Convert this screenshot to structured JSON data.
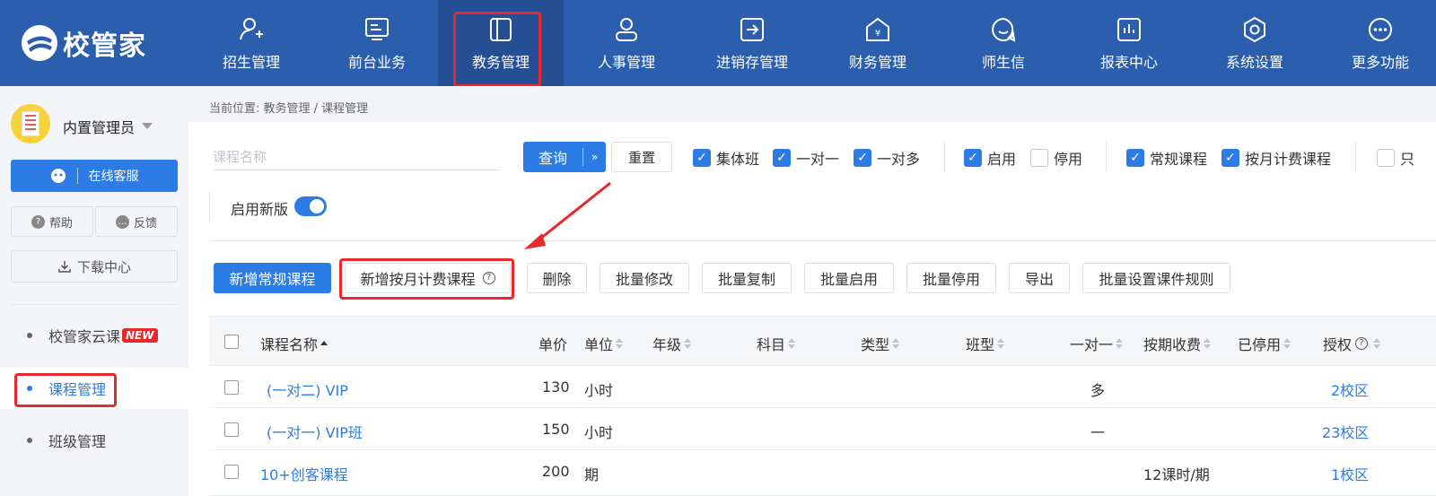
{
  "app": {
    "name": "校管家"
  },
  "nav": [
    {
      "label": "招生管理",
      "icon": "user-plus-icon"
    },
    {
      "label": "前台业务",
      "icon": "monitor-icon"
    },
    {
      "label": "教务管理",
      "icon": "book-icon",
      "active": true
    },
    {
      "label": "人事管理",
      "icon": "person-icon"
    },
    {
      "label": "进销存管理",
      "icon": "arrow-in-box-icon"
    },
    {
      "label": "财务管理",
      "icon": "yen-house-icon"
    },
    {
      "label": "师生信",
      "icon": "chat-bubble-icon"
    },
    {
      "label": "报表中心",
      "icon": "chart-icon"
    },
    {
      "label": "系统设置",
      "icon": "gear-icon"
    },
    {
      "label": "更多功能",
      "icon": "more-icon"
    }
  ],
  "sidebar": {
    "username": "内置管理员",
    "service_label": "在线客服",
    "help_label": "帮助",
    "feedback_label": "反馈",
    "download_label": "下载中心",
    "menu": [
      {
        "label": "校管家云课",
        "badge": "NEW"
      },
      {
        "label": "课程管理",
        "active": true
      },
      {
        "label": "班级管理"
      }
    ]
  },
  "breadcrumb": "当前位置: 教务管理 / 课程管理",
  "filters": {
    "search_placeholder": "课程名称",
    "query_label": "查询",
    "reset_label": "重置",
    "checkboxes": [
      {
        "label": "集体班",
        "checked": true
      },
      {
        "label": "一对一",
        "checked": true
      },
      {
        "label": "一对多",
        "checked": true
      },
      {
        "label": "启用",
        "checked": true
      },
      {
        "label": "停用",
        "checked": false
      },
      {
        "label": "常规课程",
        "checked": true
      },
      {
        "label": "按月计费课程",
        "checked": true
      },
      {
        "label": "只",
        "checked": false
      }
    ],
    "new_version_label": "启用新版",
    "new_version_on": true
  },
  "actions": {
    "add_regular": "新增常规课程",
    "add_monthly": "新增按月计费课程",
    "delete": "删除",
    "batch_edit": "批量修改",
    "batch_copy": "批量复制",
    "batch_enable": "批量启用",
    "batch_disable": "批量停用",
    "export": "导出",
    "batch_rules": "批量设置课件规则"
  },
  "table": {
    "headers": [
      "课程名称",
      "单价",
      "单位",
      "年级",
      "科目",
      "类型",
      "班型",
      "一对一",
      "按期收费",
      "已停用",
      "授权"
    ],
    "rows": [
      {
        "name": "(一对二) VIP",
        "price": "130",
        "unit": "小时",
        "one_on_one": "多",
        "period_fee": "",
        "auth": "2校区"
      },
      {
        "name": "(一对一) VIP班",
        "price": "150",
        "unit": "小时",
        "one_on_one": "一",
        "period_fee": "",
        "auth": "23校区"
      },
      {
        "name": "10+创客课程",
        "price": "200",
        "unit": "期",
        "one_on_one": "",
        "period_fee": "12课时/期",
        "auth": "1校区"
      }
    ]
  },
  "colors": {
    "topbar": "#2b5fae",
    "accent": "#2d7be5",
    "highlight": "#e8282a"
  }
}
